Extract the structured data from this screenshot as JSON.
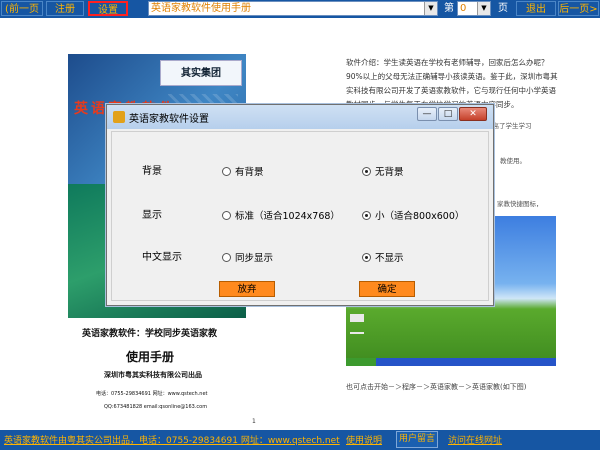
{
  "toolbar": {
    "prev_label": "(前一页",
    "register_label": "注册",
    "settings_label": "设置",
    "manual_selected": "英语家教软件使用手册",
    "page_prefix": "第",
    "page_value": "0",
    "page_suffix": "页",
    "exit_label": "退出",
    "next_label": "后一页>"
  },
  "document": {
    "intro_text": "软件介绍：学生读英语在学校有老师辅导，回家后怎么办呢？ 90%以上的父母无法正确辅导小孩读英语。鉴于此，深圳市粤其实科技有限公司开发了英语家教软件，它与现行任何中小学英语教材同步，与学生每天在学校学习的英语内容同步。",
    "intro_end": "提高了学生学习",
    "note_1": "教使用。",
    "note_2": "家教快捷图标，",
    "cover_logo": "其实集团",
    "cover_word": "英语家教软件",
    "cover_subtitle": "英语家教软件：学校同步英语家教",
    "cover_title": "使用手册",
    "cover_publisher": "深圳市粤其实科技有限公司出品",
    "cover_tel": "电话：0755-29834691  网址：www.qstech.net",
    "cover_mail": "QQ:673481828  email:qsonline@163.com",
    "page_number": "1",
    "screenshot_caption": "也可点击开始－＞程序－＞英语家教－＞英语家教(如下图)"
  },
  "dialog": {
    "title": "英语家教软件设置",
    "min_glyph": "—",
    "max_glyph": "□",
    "close_glyph": "✕",
    "rows": [
      {
        "label": "背景",
        "option_a": "有背景",
        "option_b": "无背景",
        "selected": "b"
      },
      {
        "label": "显示",
        "option_a": "标准（适合1024x768）",
        "option_b": "小（适合800x600）",
        "selected": "b"
      },
      {
        "label": "中文显示",
        "option_a": "同步显示",
        "option_b": "不显示",
        "selected": "b"
      }
    ],
    "cancel_label": "放弃",
    "ok_label": "确定"
  },
  "bottombar": {
    "info_link": "英语家教软件由粤其实公司出品，电话：0755-29834691 网址：www.qstech.net",
    "help_label": "使用说明",
    "message_label": "用户留言",
    "site_label": "访问在线网址"
  },
  "colors": {
    "bar_blue": "#1656a3",
    "accent_orange": "#ffb400",
    "button_orange": "#ff8a1e"
  }
}
